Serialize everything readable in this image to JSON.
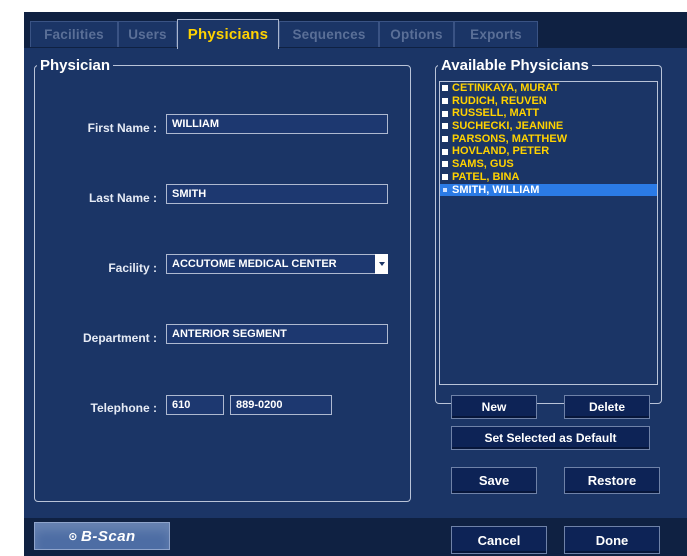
{
  "tabs": [
    {
      "label": "Facilities"
    },
    {
      "label": "Users"
    },
    {
      "label": "Physicians",
      "active": true
    },
    {
      "label": "Sequences"
    },
    {
      "label": "Options"
    },
    {
      "label": "Exports"
    }
  ],
  "physician": {
    "title": "Physician",
    "first_name_label": "First Name :",
    "first_name": "WILLIAM",
    "last_name_label": "Last Name :",
    "last_name": "SMITH",
    "facility_label": "Facility :",
    "facility": "ACCUTOME MEDICAL CENTER",
    "department_label": "Department :",
    "department": "ANTERIOR SEGMENT",
    "telephone_label": "Telephone :",
    "phone_area": "610",
    "phone_number": "889-0200"
  },
  "available": {
    "title": "Available Physicians",
    "items": [
      "CETINKAYA, MURAT",
      "RUDICH, REUVEN",
      "RUSSELL, MATT",
      "SUCHECKI, JEANINE",
      "PARSONS, MATTHEW",
      "HOVLAND, PETER",
      "SAMS, GUS",
      "PATEL, BINA",
      "SMITH, WILLIAM"
    ],
    "selected": "SMITH, WILLIAM",
    "new_label": "New",
    "delete_label": "Delete",
    "set_default_label": "Set Selected as Default"
  },
  "actions": {
    "save_label": "Save",
    "restore_label": "Restore",
    "cancel_label": "Cancel",
    "done_label": "Done"
  },
  "logo": "B-Scan",
  "colors": {
    "background": "#1b3566",
    "frame": "#0f2142",
    "accent_text": "#ffd200",
    "selection": "#2b7be6"
  }
}
